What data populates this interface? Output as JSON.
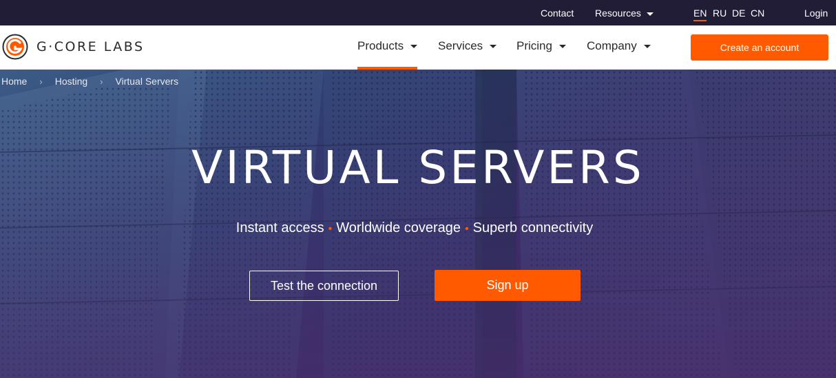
{
  "topbar": {
    "contact": "Contact",
    "resources": "Resources",
    "languages": [
      "EN",
      "RU",
      "DE",
      "CN"
    ],
    "active_language": "EN",
    "login": "Login"
  },
  "header": {
    "logo_text": "G·CORE LABS",
    "nav": [
      "Products",
      "Services",
      "Pricing",
      "Company"
    ],
    "active_nav": "Products",
    "create_account": "Create an account"
  },
  "breadcrumb": [
    "Home",
    "Hosting",
    "Virtual Servers"
  ],
  "hero": {
    "title": "VIRTUAL SERVERS",
    "features": [
      "Instant access",
      "Worldwide coverage",
      "Superb connectivity"
    ],
    "test_button": "Test the connection",
    "signup_button": "Sign up"
  },
  "colors": {
    "accent": "#ff5a00",
    "topbar_bg": "#221d37",
    "hero_bg": "#2f3f72"
  }
}
